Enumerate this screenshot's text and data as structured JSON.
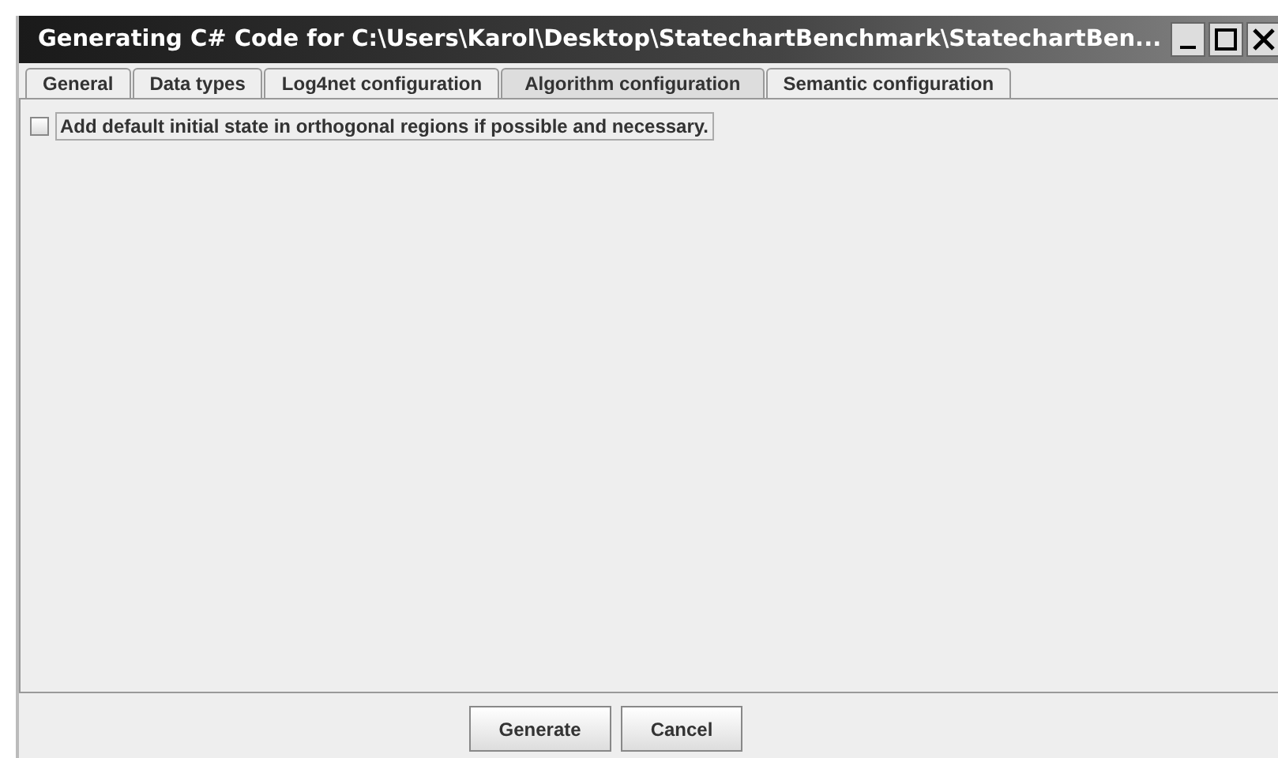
{
  "window": {
    "title": "Generating C# Code for C:\\Users\\Karol\\Desktop\\StatechartBenchmark\\StatechartBen..."
  },
  "tabs": [
    {
      "label": "General",
      "selected": false
    },
    {
      "label": "Data types",
      "selected": false
    },
    {
      "label": "Log4net configuration",
      "selected": false
    },
    {
      "label": "Algorithm configuration",
      "selected": true
    },
    {
      "label": "Semantic configuration",
      "selected": false
    }
  ],
  "options": [
    {
      "label": "Add default initial state in orthogonal regions if possible and necessary.",
      "checked": false
    }
  ],
  "buttons": [
    "Generate",
    "Cancel"
  ]
}
